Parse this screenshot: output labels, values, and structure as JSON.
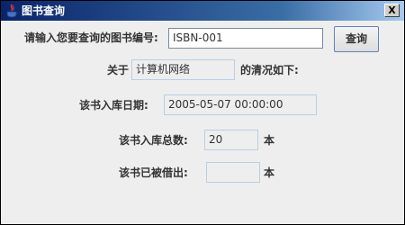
{
  "window": {
    "title": "图书查询",
    "close_glyph": "X",
    "icon": "java-app-icon"
  },
  "form": {
    "isbn_label": "请输入您要查询的图书编号:",
    "isbn_value": "ISBN-001",
    "query_button": "查询",
    "about_label": "关于",
    "book_name": "计算机网络",
    "status_suffix": "的清况如下:",
    "date_label": "该书入库日期:",
    "date_value": "2005-05-07 00:00:00",
    "total_label": "该书入库总数:",
    "total_value": "20",
    "total_unit": "本",
    "borrowed_label": "该书已被借出:",
    "borrowed_value": "",
    "borrowed_unit": "本"
  },
  "colors": {
    "title_gradient_start": "#0a246a",
    "title_gradient_end": "#a6caf0",
    "panel_background": "#eeeeee",
    "field_border": "#b8cfe5"
  }
}
